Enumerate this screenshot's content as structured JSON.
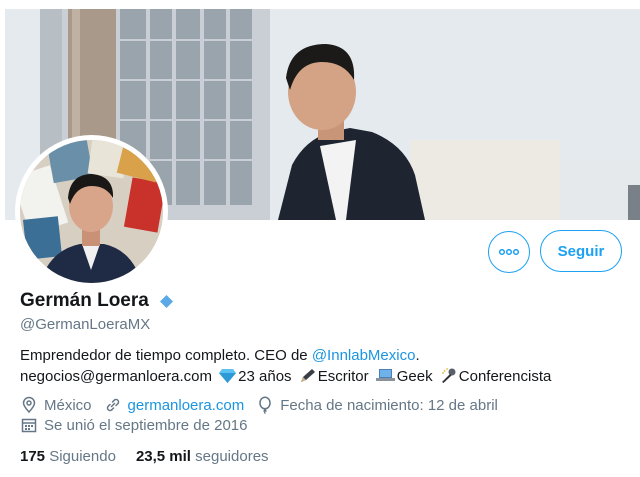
{
  "profile": {
    "name": "Germán Loera",
    "handle": "@GermanLoeraMX",
    "bio": {
      "line1_text": "Emprendedor de tiempo completo. CEO de ",
      "line1_mention": "@InnlabMexico",
      "line1_end": ".",
      "email": "negocios@germanloera.com",
      "age": "23 años",
      "role1": "Escritor",
      "role2": "Geek",
      "role3": "Conferencista"
    },
    "location": "México",
    "website": "germanloera.com",
    "birthday": "Fecha de nacimiento: 12 de abril",
    "joined": "Se unió el septiembre de 2016"
  },
  "actions": {
    "follow_label": "Seguir"
  },
  "stats": {
    "following_count": "175",
    "following_label": "Siguiendo",
    "followers_count": "23,5 mil",
    "followers_label": "seguidores"
  },
  "icons": [
    "more-icon",
    "verified-icon",
    "gem-icon",
    "pen-icon",
    "laptop-icon",
    "microphone-icon",
    "location-icon",
    "link-icon",
    "balloon-icon",
    "calendar-icon"
  ],
  "colors": {
    "accent": "#1da1f2",
    "link": "#1b95e0",
    "secondary_text": "#657786",
    "primary_text": "#14171a"
  }
}
